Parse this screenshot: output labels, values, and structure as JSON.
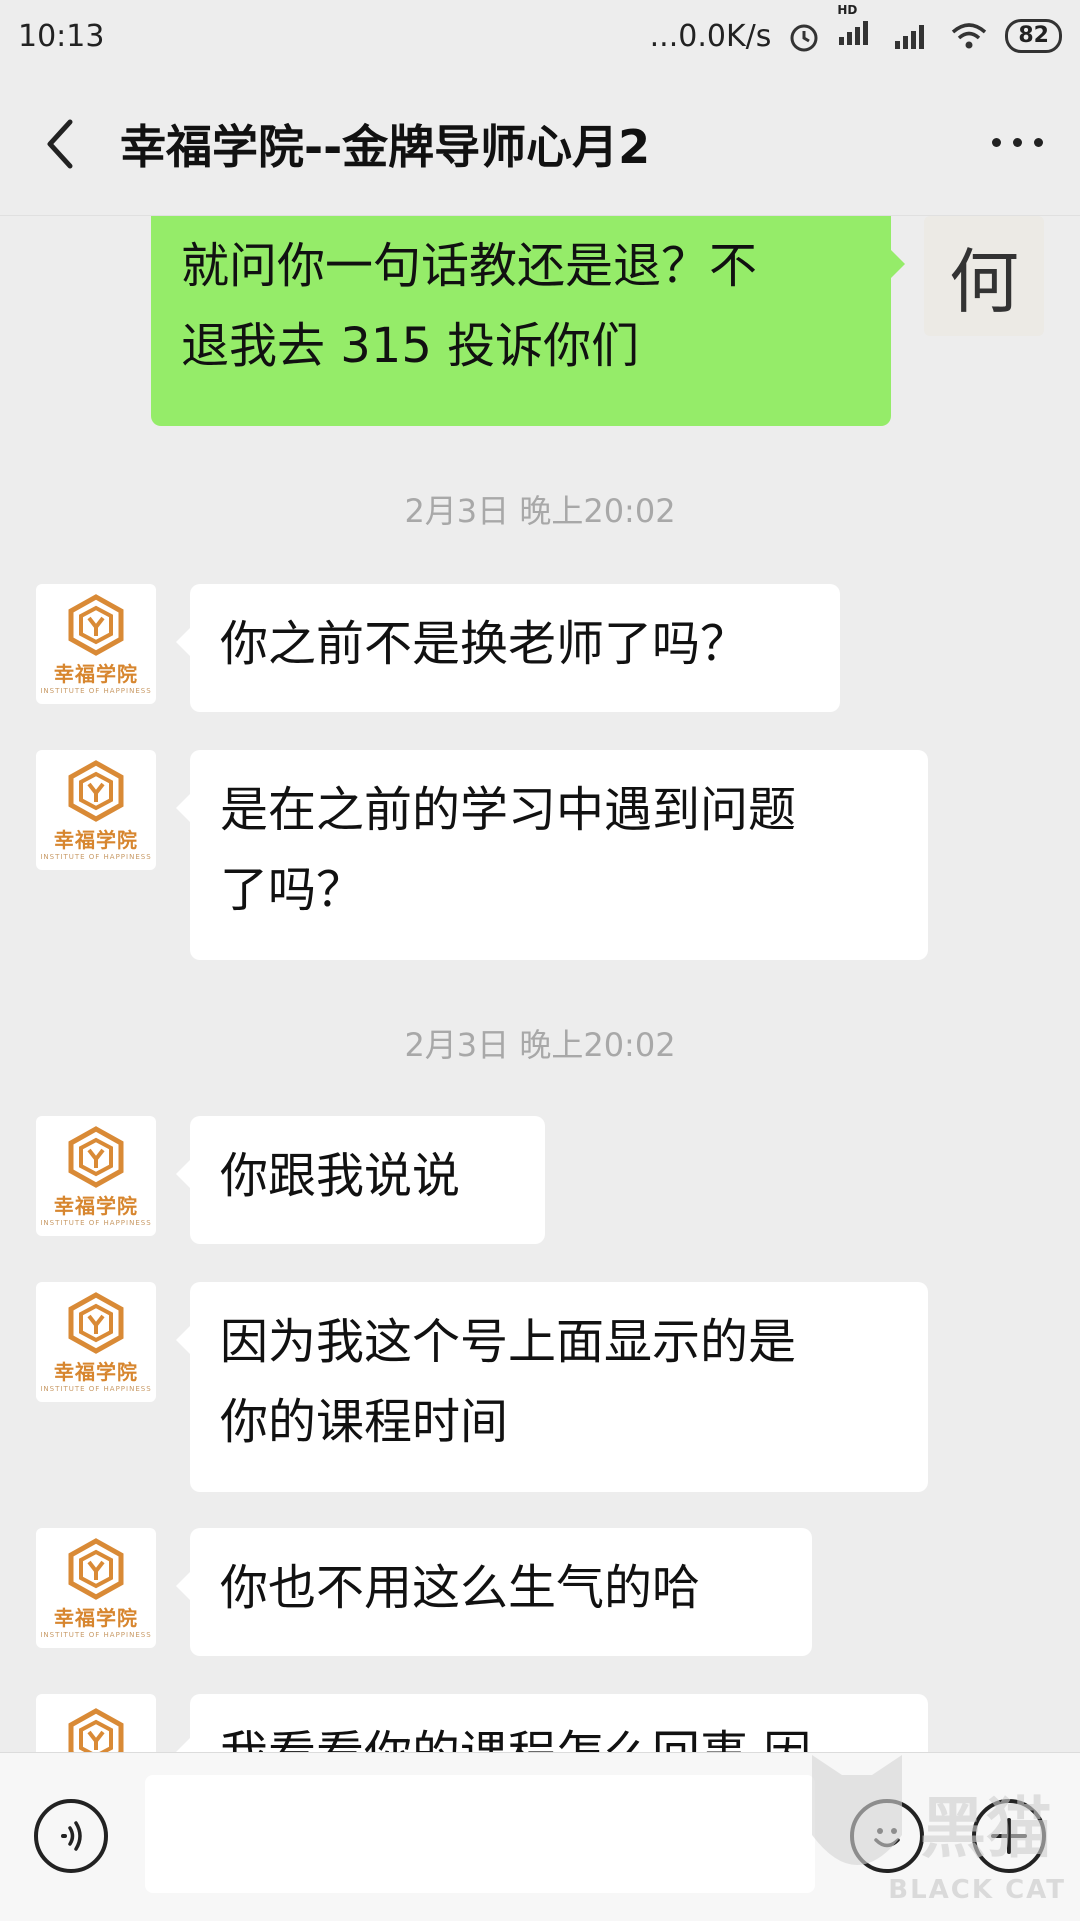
{
  "status_bar": {
    "time": "10:13",
    "network_speed": "...0.0K/s",
    "battery": "82",
    "hd_label": "HD"
  },
  "header": {
    "title": "幸福学院--金牌导师心月2"
  },
  "contact_avatar_text": "幸福学院",
  "contact_avatar_subtext": "INSTITUTE OF HAPPINESS",
  "my_avatar_text": "何",
  "messages": [
    {
      "type": "sent",
      "text": "就问你一句话教还是退？不退我去 315 投诉你们",
      "lines": [
        "就问你一句话教还是退？不",
        "退我去 315 投诉你们"
      ]
    },
    {
      "type": "time",
      "text": "2月3日 晚上20:02"
    },
    {
      "type": "received",
      "lines": [
        "你之前不是换老师了吗？"
      ]
    },
    {
      "type": "received",
      "lines": [
        "是在之前的学习中遇到问题",
        "了吗？"
      ]
    },
    {
      "type": "time",
      "text": "2月3日 晚上20:02"
    },
    {
      "type": "received",
      "lines": [
        "你跟我说说"
      ]
    },
    {
      "type": "received",
      "lines": [
        "因为我这个号上面显示的是",
        "你的课程时间"
      ]
    },
    {
      "type": "received",
      "lines": [
        "你也不用这么生气的哈"
      ]
    },
    {
      "type": "received",
      "lines": [
        "我看看你的课程怎么回事 因"
      ]
    }
  ],
  "watermark": {
    "zh": "黑猫",
    "en": "BLACK CAT"
  },
  "icons": [
    "back-arrow-icon",
    "more-dots-icon",
    "voice-icon",
    "emoji-icon",
    "plus-icon",
    "signal-icon",
    "wifi-icon",
    "alarm-icon"
  ]
}
